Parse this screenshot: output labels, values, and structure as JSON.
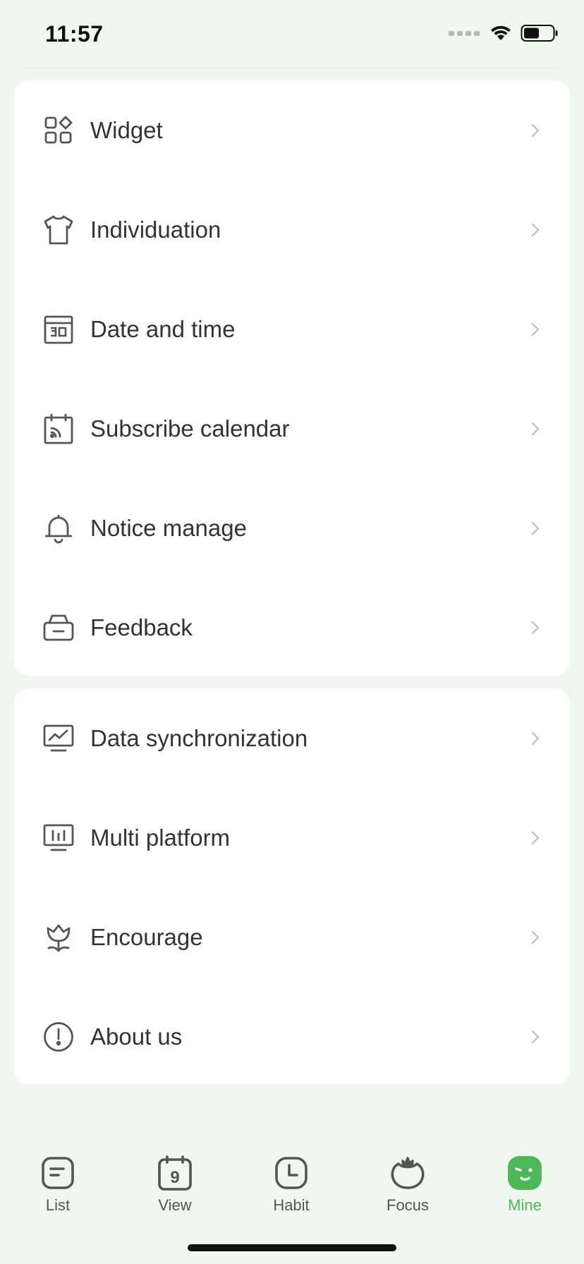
{
  "status_bar": {
    "time": "11:57"
  },
  "group_1": [
    {
      "label": "Widget",
      "icon": "widget-icon"
    },
    {
      "label": "Individuation",
      "icon": "shirt-icon"
    },
    {
      "label": "Date and time",
      "icon": "calendar-30-icon"
    },
    {
      "label": "Subscribe calendar",
      "icon": "calendar-feed-icon"
    },
    {
      "label": "Notice manage",
      "icon": "bell-icon"
    },
    {
      "label": "Feedback",
      "icon": "feedback-briefcase-icon"
    }
  ],
  "group_2": [
    {
      "label": "Data synchronization",
      "icon": "chart-monitor-icon"
    },
    {
      "label": "Multi platform",
      "icon": "bars-monitor-icon"
    },
    {
      "label": "Encourage",
      "icon": "tulip-icon"
    },
    {
      "label": "About us",
      "icon": "info-circle-icon"
    }
  ],
  "tab_bar": {
    "tabs": [
      {
        "label": "List",
        "icon": "list-icon",
        "active": false
      },
      {
        "label": "View",
        "icon": "calendar-9-icon",
        "badge": "9",
        "active": false
      },
      {
        "label": "Habit",
        "icon": "clock-icon",
        "active": false
      },
      {
        "label": "Focus",
        "icon": "tomato-icon",
        "active": false
      },
      {
        "label": "Mine",
        "icon": "mine-face-icon",
        "active": true
      }
    ]
  },
  "colors": {
    "background": "#eff7ee",
    "card": "#ffffff",
    "accent": "#4cb85a",
    "text": "#333333",
    "chevron": "#bdbdbd"
  }
}
